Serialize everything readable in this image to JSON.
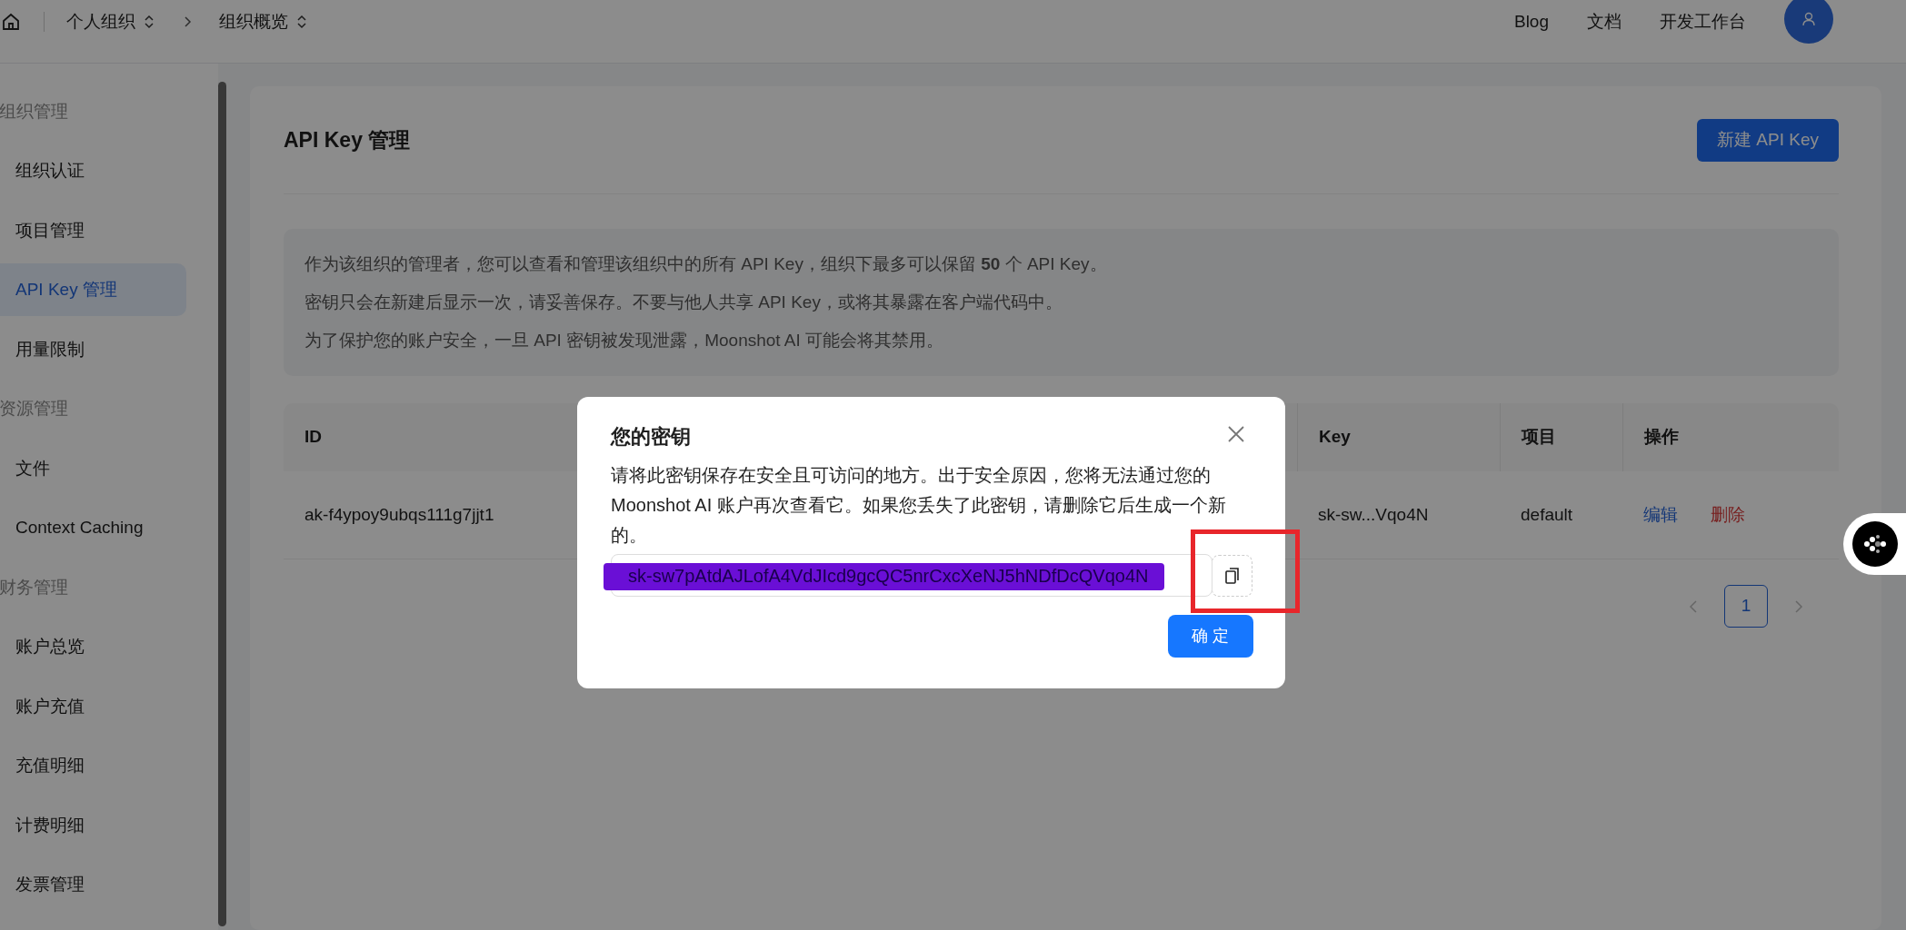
{
  "topbar": {
    "breadcrumb": [
      {
        "label": "个人组织"
      },
      {
        "label": "组织概览"
      }
    ],
    "links": [
      "Blog",
      "文档",
      "开发工作台"
    ]
  },
  "sidebar": {
    "sections": [
      {
        "heading": "组织管理",
        "items": [
          {
            "label": "组织认证",
            "selected": false
          },
          {
            "label": "项目管理",
            "selected": false
          },
          {
            "label": "API Key 管理",
            "selected": true
          },
          {
            "label": "用量限制",
            "selected": false
          }
        ]
      },
      {
        "heading": "资源管理",
        "items": [
          {
            "label": "文件",
            "selected": false
          },
          {
            "label": "Context Caching",
            "selected": false
          }
        ]
      },
      {
        "heading": "财务管理",
        "items": [
          {
            "label": "账户总览",
            "selected": false
          },
          {
            "label": "账户充值",
            "selected": false
          },
          {
            "label": "充值明细",
            "selected": false
          },
          {
            "label": "计费明细",
            "selected": false
          },
          {
            "label": "发票管理",
            "selected": false
          }
        ]
      }
    ]
  },
  "main": {
    "title": "API Key 管理",
    "new_button": "新建 API Key",
    "notice": [
      "作为该组织的管理者，您可以查看和管理该组织中的所有 API Key，组织下最多可以保留 **50** 个 API Key。",
      "密钥只会在新建后显示一次，请妥善保存。不要与他人共享 API Key，或将其暴露在客户端代码中。",
      "为了保护您的账户安全，一旦 API 密钥被发现泄露，Moonshot AI 可能会将其禁用。"
    ],
    "table": {
      "columns": [
        "ID",
        "Key",
        "项目",
        "操作"
      ],
      "rows": [
        {
          "id": "ak-f4ypoy9ubqs111g7jjt1",
          "key": "sk-sw...Vqo4N",
          "project": "default",
          "actions": [
            {
              "label": "编辑",
              "kind": "edit"
            },
            {
              "label": "删除",
              "kind": "delete"
            }
          ]
        }
      ]
    },
    "pagination": {
      "pages": [
        {
          "label": "1",
          "selected": true
        }
      ]
    }
  },
  "modal": {
    "title": "您的密钥",
    "message": "请将此密钥保存在安全且可访问的地方。出于安全原因，您将无法通过您的 Moonshot AI 账户再次查看它。如果您丢失了此密钥，请删除它后生成一个新的。",
    "key_value": "sk-sw7pAtdAJLofA4VdJIcd9gcQC5nrCxcXeNJ5hNDfDcQVqo4N",
    "ok_button": "确 定"
  },
  "annotations": [
    {
      "kind": "scribble",
      "color": "#6a0fd6"
    },
    {
      "kind": "frame",
      "color": "#e8262b"
    }
  ]
}
